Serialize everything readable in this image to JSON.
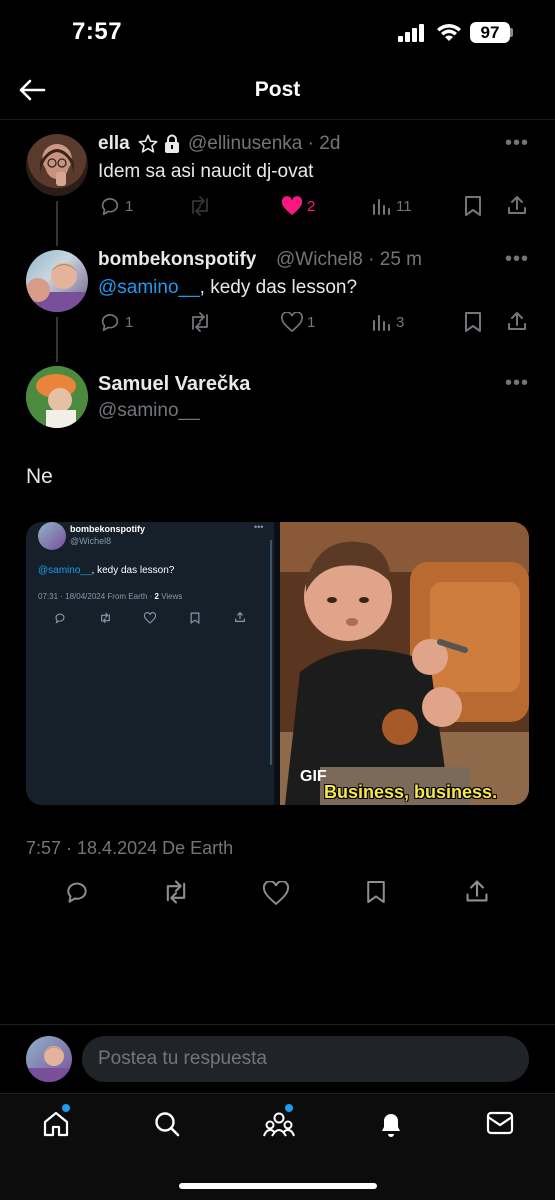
{
  "status_bar": {
    "time": "7:57",
    "battery": "97"
  },
  "header": {
    "title": "Post"
  },
  "thread": [
    {
      "name": "ella",
      "badges": [
        "star-icon",
        "lock-icon"
      ],
      "handle": "@ellinusenka",
      "time": "2d",
      "text": "Idem sa asi naucit dj-ovat",
      "replies": "1",
      "likes": "2",
      "views": "11",
      "liked": true
    },
    {
      "name": "bombekonspotify",
      "handle": "@Wichel8",
      "time": "25 m",
      "mention": "@samino__",
      "text": ", kedy das lesson?",
      "replies": "1",
      "likes": "1",
      "views": "3"
    }
  ],
  "main_post": {
    "name": "Samuel Varečka",
    "handle": "@samino__",
    "text": "Ne",
    "media": {
      "left": {
        "name": "bombekonspotify",
        "handle": "@Wichel8",
        "mention": "@samino__",
        "text": ", kedy das lesson?",
        "meta": "07:31 · 18/04/2024 From Earth · ",
        "views_count": "2",
        "views_label": " Views"
      },
      "right": {
        "badge": "GIF",
        "caption": "Business, business."
      }
    },
    "meta": "7:57 · 18.4.2024 De Earth"
  },
  "reply_bar": {
    "placeholder": "Postea tu respuesta"
  },
  "colors": {
    "accent": "#1d9bf0",
    "like": "#f91880",
    "background": "#000000"
  }
}
